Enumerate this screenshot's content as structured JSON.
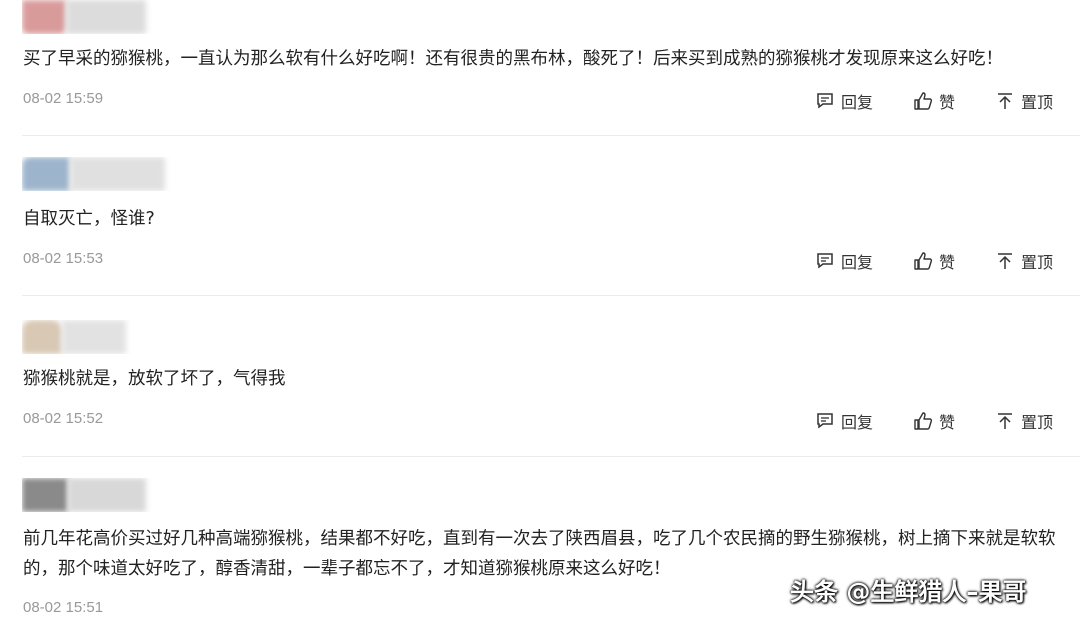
{
  "comments": [
    {
      "text": "买了早采的猕猴桃，一直认为那么软有什么好吃啊！还有很贵的黑布林，酸死了！后来买到成熟的猕猴桃才发现原来这么好吃！",
      "time": "08-02 15:59",
      "reply_label": "回复",
      "like_label": "赞",
      "pin_label": "置顶"
    },
    {
      "text": "自取灭亡，怪谁?",
      "time": "08-02 15:53",
      "reply_label": "回复",
      "like_label": "赞",
      "pin_label": "置顶"
    },
    {
      "text": "猕猴桃就是，放软了坏了，气得我",
      "time": "08-02 15:52",
      "reply_label": "回复",
      "like_label": "赞",
      "pin_label": "置顶"
    },
    {
      "text": "前几年花高价买过好几种高端猕猴桃，结果都不好吃，直到有一次去了陕西眉县，吃了几个农民摘的野生猕猴桃，树上摘下来就是软软的，那个味道太好吃了，醇香清甜，一辈子都忘不了，才知道猕猴桃原来这么好吃！",
      "time": "08-02 15:51"
    }
  ],
  "watermark": "头条 @生鲜猎人–果哥",
  "icons": {
    "reply": "comment-icon",
    "like": "thumbs-up-icon",
    "pin": "pin-top-icon"
  },
  "colors": {
    "text": "#222222",
    "time": "#999999",
    "divider": "#ececec"
  }
}
